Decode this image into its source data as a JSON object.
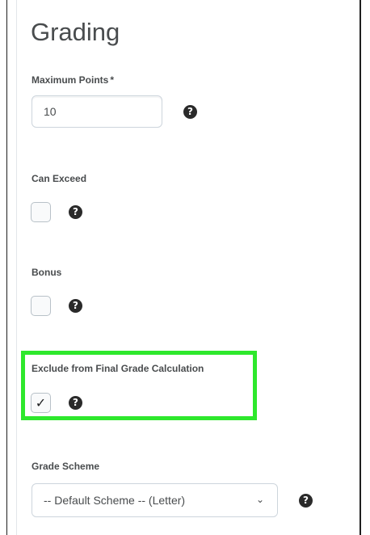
{
  "section": {
    "title": "Grading"
  },
  "max_points": {
    "label": "Maximum Points",
    "required_marker": "*",
    "value": "10"
  },
  "can_exceed": {
    "label": "Can Exceed",
    "checked": false
  },
  "bonus": {
    "label": "Bonus",
    "checked": false
  },
  "exclude_final": {
    "label": "Exclude from Final Grade Calculation",
    "checked": true,
    "check_glyph": "✓"
  },
  "grade_scheme": {
    "label": "Grade Scheme",
    "selected": "-- Default Scheme -- (Letter)",
    "chevron": "⌄"
  },
  "help_glyph": "?",
  "colors": {
    "highlight": "#2ee82c",
    "text": "#494c4e",
    "help_icon": "#2a2a2a"
  }
}
